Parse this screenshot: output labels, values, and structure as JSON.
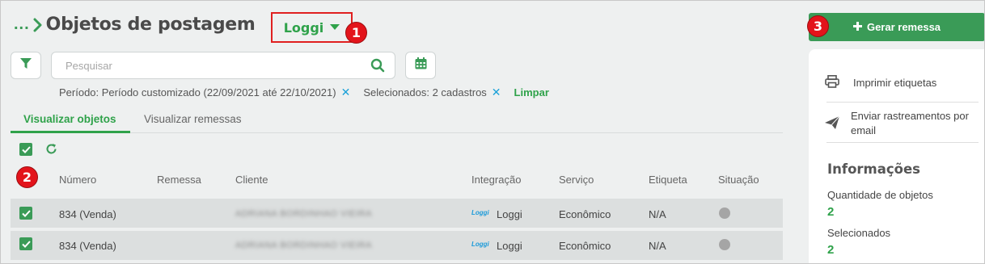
{
  "header": {
    "breadcrumb_ellipsis": "...",
    "title": "Objetos de postagem",
    "carrier": "Loggi"
  },
  "badges": {
    "b1": "1",
    "b2": "2",
    "b3": "3"
  },
  "search": {
    "placeholder": "Pesquisar"
  },
  "filters": {
    "period": "Período: Período customizado (22/09/2021 até 22/10/2021)",
    "selected": "Selecionados: 2 cadastros",
    "remove_symbol": "✕",
    "clear": "Limpar"
  },
  "tabs": [
    {
      "label": "Visualizar objetos",
      "active": true
    },
    {
      "label": "Visualizar remessas",
      "active": false
    }
  ],
  "table": {
    "headers": [
      "Número",
      "Remessa",
      "Cliente",
      "Integração",
      "Serviço",
      "Etiqueta",
      "Situação"
    ],
    "rows": [
      {
        "numero": "834 (Venda)",
        "remessa": "",
        "cliente": "ADRIANA BORDINHAO VIEIRA",
        "integracao_logo": "Loggi",
        "integracao": "Loggi",
        "servico": "Econômico",
        "etiqueta": "N/A",
        "checked": true
      },
      {
        "numero": "834 (Venda)",
        "remessa": "",
        "cliente": "ADRIANA BORDINHAO VIEIRA",
        "integracao_logo": "Loggi",
        "integracao": "Loggi",
        "servico": "Econômico",
        "etiqueta": "N/A",
        "checked": true
      }
    ]
  },
  "actions": {
    "generate": "Gerar remessa",
    "print_labels": "Imprimir etiquetas",
    "send_tracking_line1": "Enviar rastreamentos por",
    "send_tracking_line2": "email"
  },
  "info": {
    "title": "Informações",
    "qty_label": "Quantidade de objetos",
    "qty_value": "2",
    "selected_label": "Selecionados",
    "selected_value": "2"
  },
  "colors": {
    "accent": "#3a9b57",
    "badge": "#e3141b",
    "link_blue": "#1aa1d8"
  }
}
